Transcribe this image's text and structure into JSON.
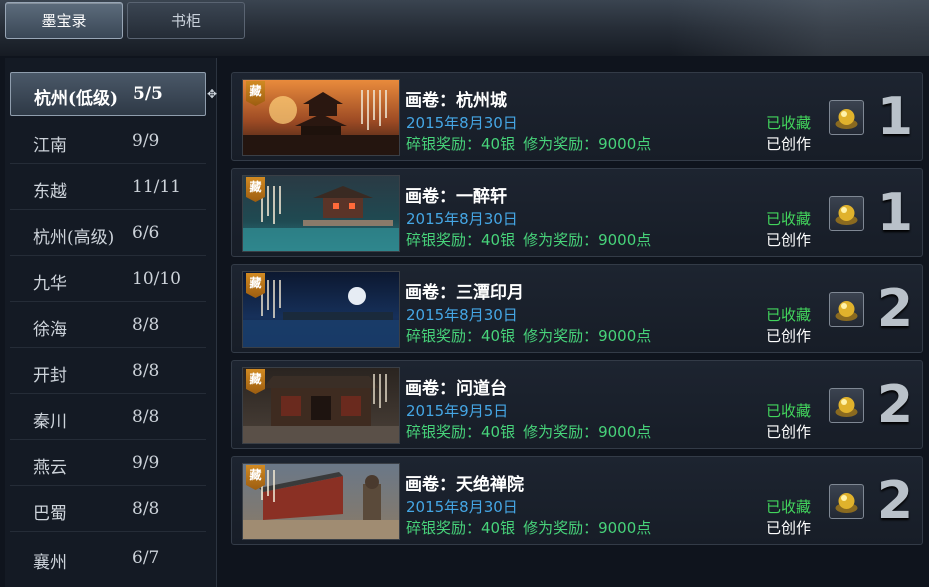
{
  "tabs": [
    {
      "label": "墨宝录",
      "active": true
    },
    {
      "label": "书柜",
      "active": false
    }
  ],
  "sidebar": {
    "items": [
      {
        "name": "杭州(低级)",
        "count": "5/5"
      },
      {
        "name": "江南",
        "count": "9/9"
      },
      {
        "name": "东越",
        "count": "11/11"
      },
      {
        "name": "杭州(高级)",
        "count": "6/6"
      },
      {
        "name": "九华",
        "count": "10/10"
      },
      {
        "name": "徐海",
        "count": "8/8"
      },
      {
        "name": "开封",
        "count": "8/8"
      },
      {
        "name": "秦川",
        "count": "8/8"
      },
      {
        "name": "燕云",
        "count": "9/9"
      },
      {
        "name": "巴蜀",
        "count": "8/8"
      },
      {
        "name": "襄州",
        "count": "6/7"
      }
    ]
  },
  "scrolls": [
    {
      "stamp": "藏",
      "title": "画卷：杭州城",
      "date": "2015年8月30日",
      "silver": "碎银奖励：40银",
      "xp": "修为奖励：9000点",
      "collected": "已收藏",
      "created": "已创作",
      "rank": "1",
      "scene": "sunset"
    },
    {
      "stamp": "藏",
      "title": "画卷：一醉轩",
      "date": "2015年8月30日",
      "silver": "碎银奖励：40银",
      "xp": "修为奖励：9000点",
      "collected": "已收藏",
      "created": "已创作",
      "rank": "1",
      "scene": "teal"
    },
    {
      "stamp": "藏",
      "title": "画卷：三潭印月",
      "date": "2015年8月30日",
      "silver": "碎银奖励：40银",
      "xp": "修为奖励：9000点",
      "collected": "已收藏",
      "created": "已创作",
      "rank": "2",
      "scene": "night"
    },
    {
      "stamp": "藏",
      "title": "画卷：问道台",
      "date": "2015年9月5日",
      "silver": "碎银奖励：40银",
      "xp": "修为奖励：9000点",
      "collected": "已收藏",
      "created": "已创作",
      "rank": "2",
      "scene": "hall"
    },
    {
      "stamp": "藏",
      "title": "画卷：天绝禅院",
      "date": "2015年8月30日",
      "silver": "碎银奖励：40银",
      "xp": "修为奖励：9000点",
      "collected": "已收藏",
      "created": "已创作",
      "rank": "2",
      "scene": "temple"
    }
  ]
}
